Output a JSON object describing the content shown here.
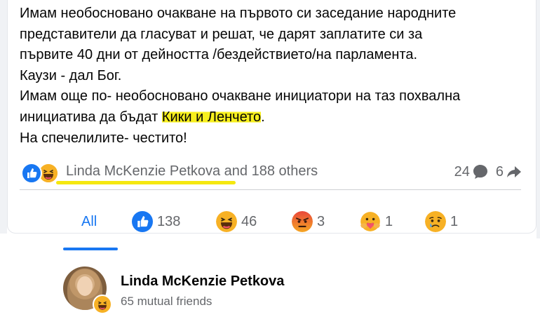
{
  "post": {
    "lines": [
      "Имам необосновано очакване на първото си заседание народните",
      "представители да гласуват и решат, че дарят заплатите си за",
      "първите 40 дни от дейността  /бездействието/на парламента.",
      "Каузи - дал Бог.",
      "Имам още по- необосновано очакване инициатори на таз похвална",
      "инициатива да бъдат ",
      "Кики и Ленчето",
      ".",
      "На спечелилите- честито!"
    ]
  },
  "reactions_summary": {
    "icons": [
      "like-icon",
      "haha-icon"
    ],
    "text": "Linda McKenzie Petkova and 188 others",
    "comments_count": "24",
    "shares_count": "6"
  },
  "tabs": [
    {
      "label": "All",
      "icon": ""
    },
    {
      "label": "138",
      "icon": "like-icon"
    },
    {
      "label": "46",
      "icon": "haha-icon"
    },
    {
      "label": "3",
      "icon": "angry-icon"
    },
    {
      "label": "1",
      "icon": "care-icon"
    },
    {
      "label": "1",
      "icon": "sad-icon"
    }
  ],
  "person": {
    "name": "Linda McKenzie Petkova",
    "mutual": "65 mutual friends",
    "reaction": "haha-icon"
  },
  "colors": {
    "accent": "#1877f2",
    "highlight": "#f7ef1e",
    "muted": "#65676b"
  }
}
